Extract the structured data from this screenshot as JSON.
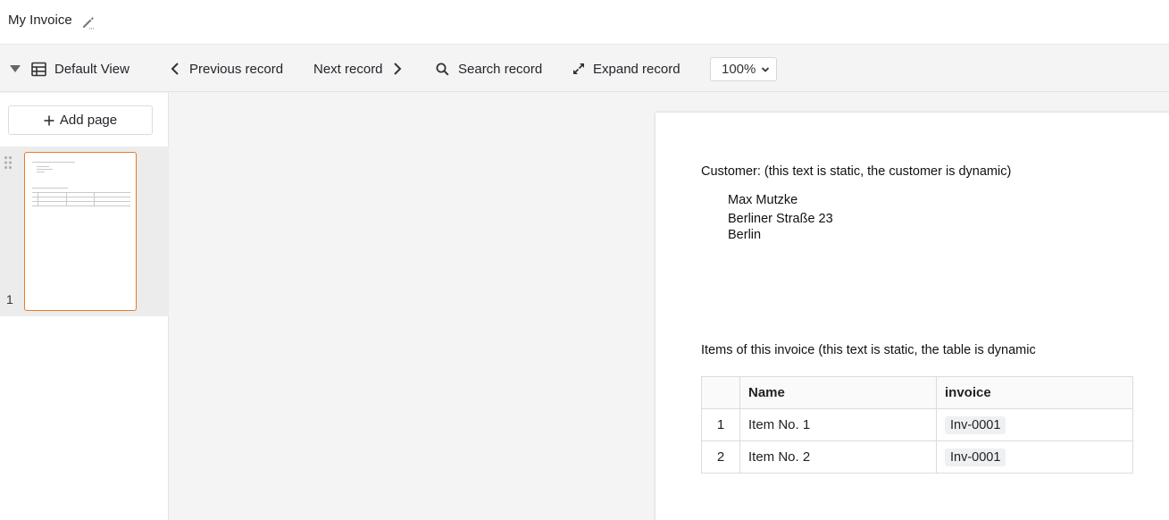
{
  "titlebar": {
    "title": "My Invoice",
    "edit_icon": "pencil-icon"
  },
  "toolbar": {
    "view_label": "Default View",
    "prev_label": "Previous record",
    "next_label": "Next record",
    "search_label": "Search record",
    "expand_label": "Expand record",
    "zoom_value": "100%"
  },
  "sidebar": {
    "add_page_label": "Add page",
    "pages": [
      {
        "number": "1"
      }
    ]
  },
  "document": {
    "customer_label": "Customer: (this text is static, the customer is dynamic)",
    "customer": {
      "name": "Max Mutzke",
      "street": "Berliner Straße 23",
      "city": "Berlin"
    },
    "items_label": "Items of this invoice (this text is static, the table is dynamic",
    "table": {
      "headers": [
        "",
        "Name",
        "invoice"
      ],
      "rows": [
        {
          "index": "1",
          "name": "Item No. 1",
          "invoice": "Inv-0001"
        },
        {
          "index": "2",
          "name": "Item No. 2",
          "invoice": "Inv-0001"
        }
      ]
    }
  }
}
